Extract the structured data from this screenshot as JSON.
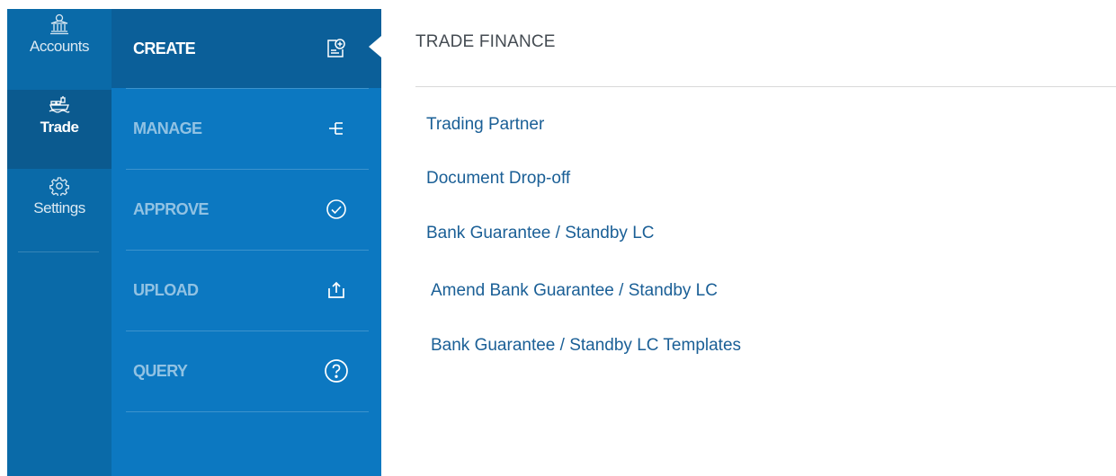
{
  "rail": {
    "items": [
      {
        "label": "Accounts",
        "icon": "bank-icon",
        "active": false
      },
      {
        "label": "Trade",
        "icon": "ship-icon",
        "active": true
      },
      {
        "label": "Settings",
        "icon": "gear-icon",
        "active": false
      }
    ]
  },
  "submenu": {
    "items": [
      {
        "label": "CREATE",
        "icon": "add-document-icon",
        "active": true
      },
      {
        "label": "MANAGE",
        "icon": "tree-icon",
        "active": false
      },
      {
        "label": "APPROVE",
        "icon": "check-circle-icon",
        "active": false
      },
      {
        "label": "UPLOAD",
        "icon": "upload-icon",
        "active": false
      },
      {
        "label": "QUERY",
        "icon": "question-circle-icon",
        "active": false
      }
    ]
  },
  "content": {
    "title": "TRADE FINANCE",
    "links": [
      "Trading Partner",
      "Document Drop-off",
      "Bank Guarantee / Standby LC",
      "Amend Bank Guarantee / Standby LC",
      "Bank Guarantee / Standby LC Templates"
    ]
  },
  "colors": {
    "rail_bg": "#0a6aa8",
    "rail_active": "#0b5a8f",
    "submenu_bg": "#0c78c1",
    "submenu_active": "#0b5f99",
    "link": "#1a5f96"
  }
}
